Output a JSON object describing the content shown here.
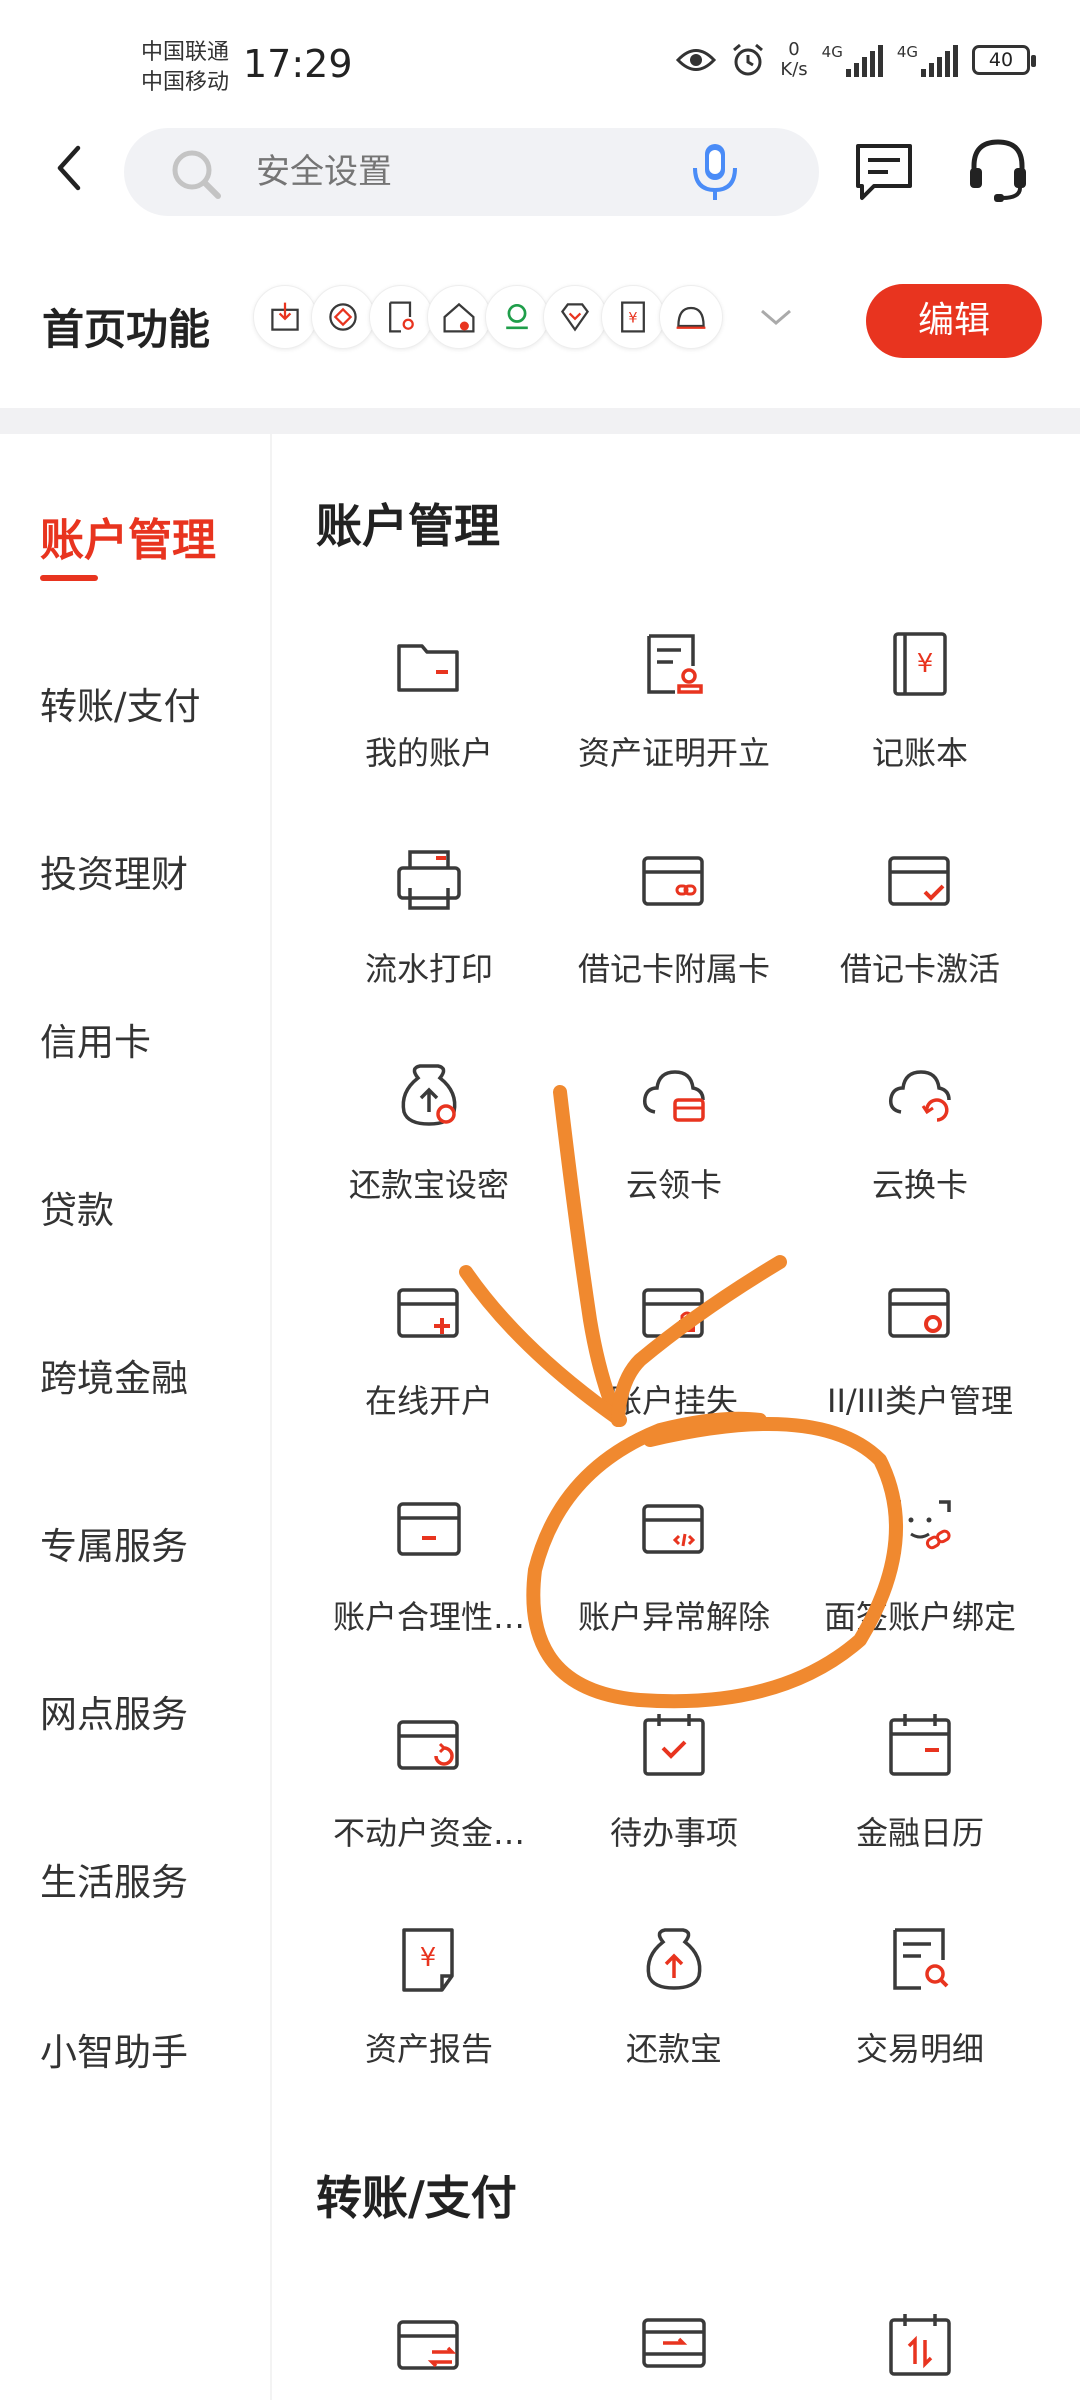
{
  "status_bar": {
    "carrier1": "中国联通",
    "carrier2": "中国移动",
    "time": "17:29",
    "net_speed_value": "0",
    "net_speed_unit": "K/s",
    "sig1": "4G",
    "sig2": "4G",
    "battery": "40"
  },
  "search": {
    "placeholder": "安全设置"
  },
  "home": {
    "title": "首页功能",
    "edit_label": "编辑",
    "quick_icons": [
      "import-icon",
      "coin-icon",
      "doc-search-icon",
      "home-lock-icon",
      "insurance-logo-icon",
      "diamond-icon",
      "yuan-card-icon",
      "bell-icon"
    ]
  },
  "nav": {
    "items": [
      "账户管理",
      "转账/支付",
      "投资理财",
      "信用卡",
      "贷款",
      "跨境金融",
      "专属服务",
      "网点服务",
      "生活服务",
      "小智助手"
    ],
    "active_index": 0
  },
  "sections": [
    {
      "title": "账户管理",
      "items": [
        {
          "label": "我的账户",
          "icon": "wallet-icon"
        },
        {
          "label": "资产证明开立",
          "icon": "certificate-icon"
        },
        {
          "label": "记账本",
          "icon": "ledger-icon"
        },
        {
          "label": "流水打印",
          "icon": "printer-icon"
        },
        {
          "label": "借记卡附属卡",
          "icon": "card-link-icon"
        },
        {
          "label": "借记卡激活",
          "icon": "card-check-icon"
        },
        {
          "label": "还款宝设密",
          "icon": "moneybag-lock-icon"
        },
        {
          "label": "云领卡",
          "icon": "cloud-card-icon"
        },
        {
          "label": "云换卡",
          "icon": "cloud-refresh-icon"
        },
        {
          "label": "在线开户",
          "icon": "card-plus-icon"
        },
        {
          "label": "账户挂失",
          "icon": "card-lock-icon"
        },
        {
          "label": "II/III类户管理",
          "icon": "card-gear-icon"
        },
        {
          "label": "账户合理性…",
          "icon": "card-minus-icon"
        },
        {
          "label": "账户异常解除",
          "icon": "card-code-icon"
        },
        {
          "label": "面签账户绑定",
          "icon": "face-link-icon"
        },
        {
          "label": "不动户资金…",
          "icon": "card-refresh-icon"
        },
        {
          "label": "待办事项",
          "icon": "calendar-check-icon"
        },
        {
          "label": "金融日历",
          "icon": "calendar-icon"
        },
        {
          "label": "资产报告",
          "icon": "yuan-report-icon"
        },
        {
          "label": "还款宝",
          "icon": "moneybag-up-icon"
        },
        {
          "label": "交易明细",
          "icon": "doc-search-icon"
        }
      ]
    },
    {
      "title": "转账/支付",
      "items": [
        {
          "label": "",
          "icon": "card-transfer-icon"
        },
        {
          "label": "",
          "icon": "card-arrow-icon"
        },
        {
          "label": "",
          "icon": "calendar-swap-icon"
        }
      ]
    }
  ],
  "colors": {
    "accent": "#e8341f",
    "annotation": "#f0892f",
    "icon_stroke": "#3a3a3a"
  }
}
